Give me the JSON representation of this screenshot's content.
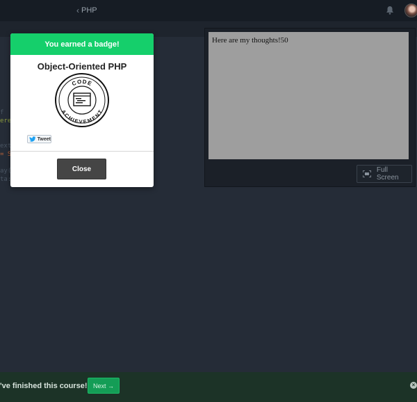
{
  "header": {
    "breadcrumb_label": "PHP",
    "breadcrumb_icon": "chevron-left-icon",
    "bell_icon": "bell-icon",
    "avatar_icon": "user-avatar"
  },
  "editor": {
    "code_fragments": [
      "",
      "",
      "",
      "",
      "",
      "",
      "",
      "",
      "f",
      "ere",
      "",
      "",
      "exte",
      "= S",
      "",
      "ay(",
      "ta:",
      ""
    ]
  },
  "preview": {
    "content_text": "Here are my thoughts!50",
    "fullscreen_label": "Full Screen",
    "fullscreen_icon": "fullscreen-icon"
  },
  "modal": {
    "header": "You earned a badge!",
    "badge_title": "Object-Oriented PHP",
    "badge_text_top": "CODE",
    "badge_text_bottom": "ACHIEVEMENT",
    "tweet_label": "Tweet",
    "close_label": "Close"
  },
  "footer": {
    "message": "'ve finished this course!",
    "next_label": "Next →",
    "dismiss_icon": "close-icon"
  },
  "colors": {
    "accent_green": "#15cf6b",
    "page_bg": "#252c37",
    "footer_bg": "#1c3327"
  }
}
